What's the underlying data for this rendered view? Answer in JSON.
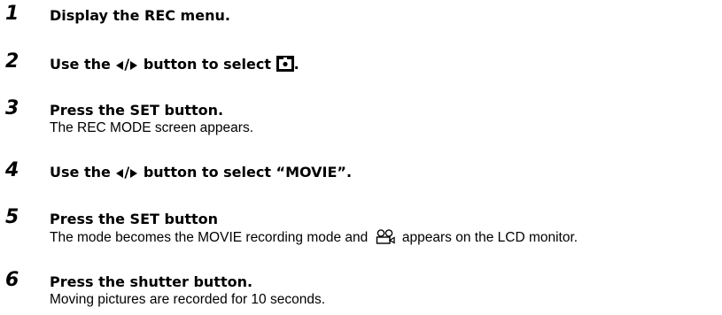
{
  "steps": [
    {
      "number": "1",
      "title": "Display the REC menu."
    },
    {
      "number": "2",
      "title_prefix": "Use the",
      "title_middle": "button to select",
      "title_suffix": ".",
      "icons": [
        "left-arrow-icon",
        "right-arrow-icon",
        "still-camera-mode-icon"
      ]
    },
    {
      "number": "3",
      "title": "Press the SET button.",
      "description": "The REC MODE screen appears."
    },
    {
      "number": "4",
      "title_prefix": "Use the",
      "title_suffix": "button to select “MOVIE”.",
      "icons": [
        "left-arrow-icon",
        "right-arrow-icon"
      ]
    },
    {
      "number": "5",
      "title": "Press the SET button",
      "description_prefix": "The mode becomes the MOVIE recording mode and",
      "description_suffix": "appears on the LCD monitor.",
      "icons": [
        "movie-camera-icon"
      ]
    },
    {
      "number": "6",
      "title": "Press the shutter button.",
      "description": "Moving pictures are recorded for 10 seconds."
    }
  ],
  "arrow_separator": "/"
}
